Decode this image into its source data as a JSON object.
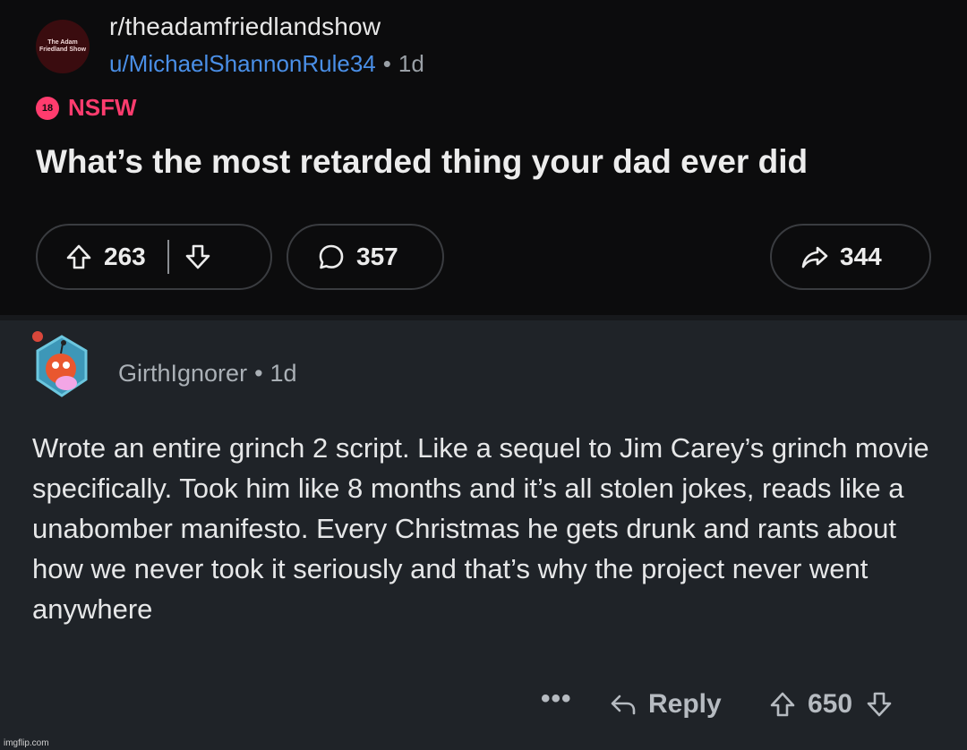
{
  "post": {
    "subreddit_avatar_text": "The Adam Friedland Show",
    "subreddit": "r/theadamfriedlandshow",
    "author": "u/MichaelShannonRule34",
    "separator": "•",
    "age": "1d",
    "nsfw_badge": "18",
    "nsfw_label": "NSFW",
    "title": "What’s the most retarded thing your dad ever did",
    "upvotes": "263",
    "comments": "357",
    "shares": "344"
  },
  "comment": {
    "username": "GirthIgnorer",
    "separator": "•",
    "age": "1d",
    "body": "Wrote an entire grinch 2 script. Like a sequel to Jim Carey’s grinch movie specifically. Took him like 8 months and it’s all stolen jokes, reads like a unabomber manifesto. Every Christmas he gets drunk and rants about how we never took it seriously and that’s why the project never went anywhere",
    "more": "•••",
    "reply_label": "Reply",
    "votes": "650"
  },
  "watermark": "imgflip.com",
  "colors": {
    "post_bg": "#0c0c0d",
    "comment_bg": "#1f2328",
    "username_link": "#4a8fe7",
    "nsfw": "#ff3c6e"
  },
  "icons": [
    "upvote-icon",
    "downvote-icon",
    "comment-bubble-icon",
    "share-arrow-icon",
    "reply-arrow-icon"
  ]
}
